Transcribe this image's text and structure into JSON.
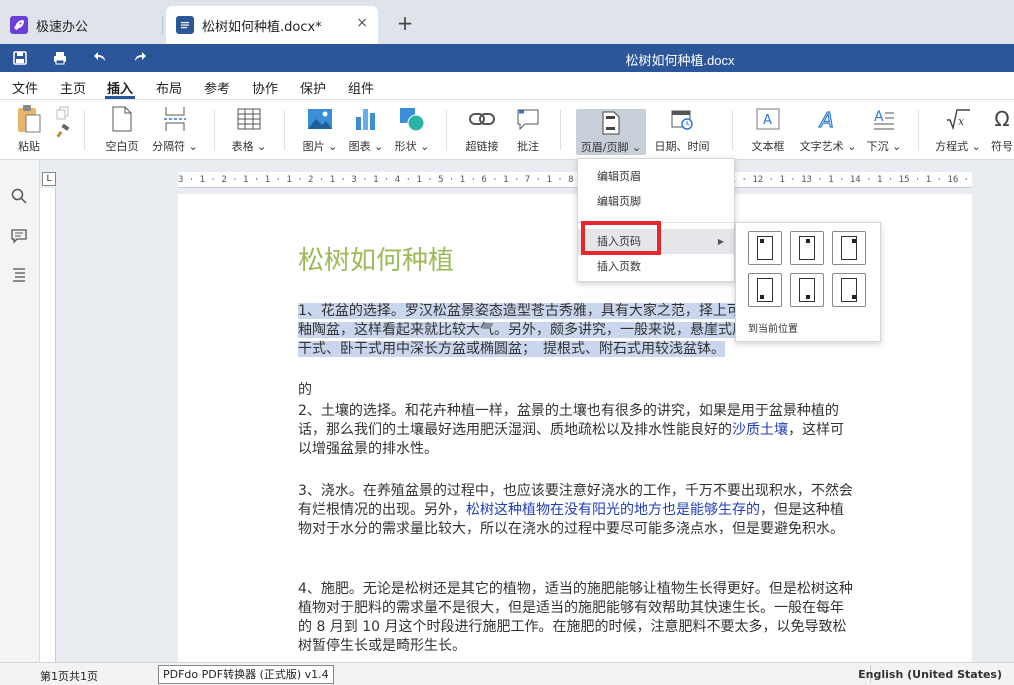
{
  "app_tabs": {
    "app_label": "极速办公",
    "doc_label": "松树如何种植.docx*",
    "close_glyph": "×",
    "new_tab_glyph": "+"
  },
  "titlebar": {
    "title": "松树如何种植.docx",
    "bg_color": "#2b579a"
  },
  "menu": {
    "items": [
      "文件",
      "主页",
      "插入",
      "布局",
      "参考",
      "协作",
      "保护",
      "组件"
    ],
    "active": "插入"
  },
  "ribbon": {
    "paste": "粘贴",
    "blank_page": "空白页",
    "separator": "分隔符",
    "table": "表格",
    "image": "图片",
    "chart": "图表",
    "shape": "形状",
    "hyperlink": "超链接",
    "comment": "批注",
    "header_footer": "页眉/页脚",
    "date_time": "日期、时间",
    "textbox": "文本框",
    "textart": "文字艺术",
    "dropcap": "下沉",
    "equation": "方程式",
    "symbol": "符号"
  },
  "dropdown": {
    "edit_header": "编辑页眉",
    "edit_footer": "编辑页脚",
    "insert_page_number": "插入页码",
    "insert_page_count": "插入页数",
    "highlight_color": "#e8262e"
  },
  "submenu": {
    "current_position": "到当前位置",
    "positions": [
      "top-left",
      "top-center",
      "top-right",
      "bottom-left",
      "bottom-center",
      "bottom-right"
    ]
  },
  "document": {
    "heading": "松树如何种植",
    "heading_color": "#9bbb59",
    "p1": "1、花盆的选择。罗汉松盆景姿态造型苍古秀雅，具有大家之范，择上可以选用紫砂陶盆或釉陶盆，这样看起来就比较大气。另外，颇多讲究，一般来说，悬崖式用高深千筒盆；　斜干式、卧干式用中深长方盆或椭圆盆；　提根式、附石式用较浅盆钵。",
    "p1_tail": "的",
    "p2_a": "2、土壤的选择。和花卉种植一样，盆景的土壤也有很多的讲究，如果是用于盆景种植的话，那么我们的土壤最好选用肥沃湿润、质地疏松以及排水性能良好的",
    "p2_link": "沙质土壤",
    "p2_b": "，这样可以增强盆景的排水性。",
    "p3_a": "3、浇水。在养殖盆景的过程中，也应该要注意好浇水的工作，千万不要出现积水，不然会有烂根情况的出现。另外，",
    "p3_link": "松树这种植物在没有阳光的地方也是能够生存的",
    "p3_b": "，但是这种植物对于水分的需求量比较大，所以在浇水的过程中要尽可能多浇点水，但是要避免积水。",
    "p4": "4、施肥。无论是松树还是其它的植物，适当的施肥能够让植物生长得更好。但是松树这种植物对于肥料的需求量不是很大，但是适当的施肥能够有效帮助其快速生长。一般在每年的 8 月到 10 月这个时段进行施肥工作。在施肥的时候，注意肥料不要太多，以免导致松树暂停生长或是畸形生长。"
  },
  "ruler": {
    "text": "3 · 1 · 2 · 1 · 1 · 1 · 2 · 1 · 3 · 1 · 4 · 1 · 5 · 1 · 6 · 1 · 7 · 1 · 8 · 1 · 9 · 1 · 10 · 1 · 11 · 1 · 12 · 1 · 13 · 1 · 14 · 1 · 15 · 1 · 16 · 1 · 17 · 1 · 18",
    "corner": "L"
  },
  "status": {
    "page_info": "第1页共1页",
    "converter": "PDFdo PDF转换器 (正式版) v1.4",
    "language": "English (United States)"
  }
}
